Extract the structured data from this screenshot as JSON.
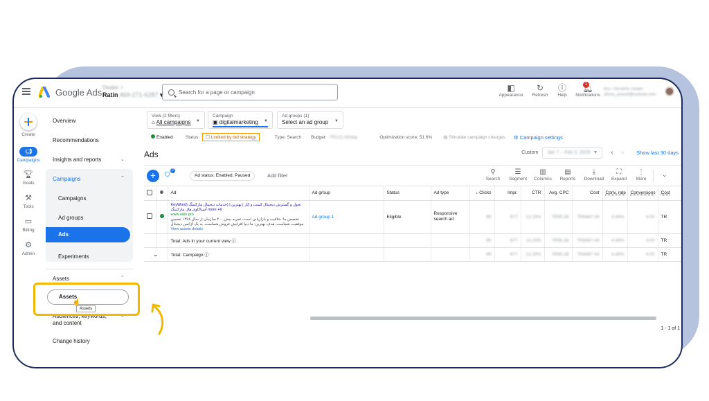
{
  "header": {
    "brand": "Google Ads",
    "account_top": "Dealer >",
    "account_name": "Ratin",
    "account_id": "469-271-6287",
    "search_placeholder": "Search for a page or campaign",
    "actions": [
      {
        "label": "Appearance",
        "icon": "appearance-icon"
      },
      {
        "label": "Refresh",
        "icon": "refresh-icon"
      },
      {
        "label": "Help",
        "icon": "help-icon"
      },
      {
        "label": "Notifications",
        "icon": "bell-icon"
      }
    ],
    "notification_count": "1",
    "user_line1": "651-799-8845 Dealer",
    "user_line2": "ahora_aousef@outlook.com"
  },
  "rail": {
    "create": "Create",
    "campaigns": "Campaigns",
    "goals": "Goals",
    "tools": "Tools",
    "billing": "Billing",
    "admin": "Admin"
  },
  "nav": {
    "overview": "Overview",
    "recommendations": "Recommendations",
    "insights": "Insights and reports",
    "campaigns_group": "Campaigns",
    "campaigns": "Campaigns",
    "ad_groups": "Ad groups",
    "ads": "Ads",
    "experiments": "Experiments",
    "assets_group": "Assets",
    "assets": "Assets",
    "tooltip": "Assets",
    "audiences": "Audiences, keywords, and content",
    "change_history": "Change history"
  },
  "filters": {
    "view_label": "View (2 filters)",
    "view_value": "All campaigns",
    "campaign_label": "Campaign",
    "campaign_value": "digitalmarketing",
    "adgroup_label": "Ad groups (1)",
    "adgroup_value": "Select an ad group"
  },
  "status_row": {
    "enabled": "Enabled",
    "status_label": "Status:",
    "status_value": "Limited by bid strategy",
    "type_label": "Type: Search",
    "budget_label": "Budget:",
    "budget_value": "TR121.00/day",
    "optimization": "Optimization score: 51.6%",
    "simulate": "Simulate campaign changes",
    "settings": "Campaign settings"
  },
  "main": {
    "title": "Ads",
    "custom_label": "Custom",
    "date_range": "Jan 7 – Feb 3, 2025",
    "show_last": "Show last 30 days"
  },
  "toolbar": {
    "chip": "Ad status: Enabled, Paused",
    "add_filter": "Add filter",
    "tools": [
      {
        "label": "Search",
        "icon": "search-icon"
      },
      {
        "label": "Segment",
        "icon": "segment-icon"
      },
      {
        "label": "Columns",
        "icon": "columns-icon"
      },
      {
        "label": "Reports",
        "icon": "reports-icon"
      },
      {
        "label": "Download",
        "icon": "download-icon"
      },
      {
        "label": "Expand",
        "icon": "expand-icon"
      },
      {
        "label": "More",
        "icon": "more-icon"
      }
    ]
  },
  "table": {
    "headers": [
      "Ad",
      "Ad group",
      "Status",
      "Ad type",
      "Clicks",
      "Impr.",
      "CTR",
      "Avg. CPC",
      "Cost",
      "Conv. rate",
      "Conversions",
      "Cost"
    ],
    "row": {
      "headline": "تحول و گسترش دیجیتال کسب و کار | بهترین | (خدمات دیجیتال مارکتینگ (KeyWord",
      "headline2": "more +6 آسیاکاوی هال مارکتینگ",
      "url": "www.ratin.pro",
      "desc": "تخصص ما: خلاقیت و بازاریابی است، تجربه بیش ۲۰۰ سازمان از سال ۱۳۷۸ تضمین موفقیت شماست. هدف بهترین: ما دنیا افزایش فروش شماست. به یک آژانس دیجیتال",
      "assets_link": "View assets details",
      "ad_group": "Ad group 1",
      "status": "Eligible",
      "ad_type": "Responsive search ad",
      "clicks": "89",
      "impr": "677",
      "ctr": "13.15%",
      "avg_cpc": "TR95.38",
      "cost": "TR8487.44",
      "conv_rate": "4.49%",
      "conversions": "4.00",
      "cost_tail": "TR"
    },
    "total_view": {
      "label": "Total: Ads in your current view",
      "clicks": "89",
      "impr": "677",
      "ctr": "13.15%",
      "avg_cpc": "TR95.38",
      "cost": "TR8487.44",
      "conv_rate": "4.49%",
      "conversions": "4.00",
      "cost_tail": "TR"
    },
    "total_campaign": {
      "label": "Total: Campaign",
      "clicks": "89",
      "impr": "677",
      "ctr": "13.15%",
      "avg_cpc": "TR95.38",
      "cost": "TR8487.44",
      "conv_rate": "4.49%",
      "conversions": "4.00",
      "cost_tail": "TR"
    },
    "pager": "1 - 1 of 1"
  }
}
